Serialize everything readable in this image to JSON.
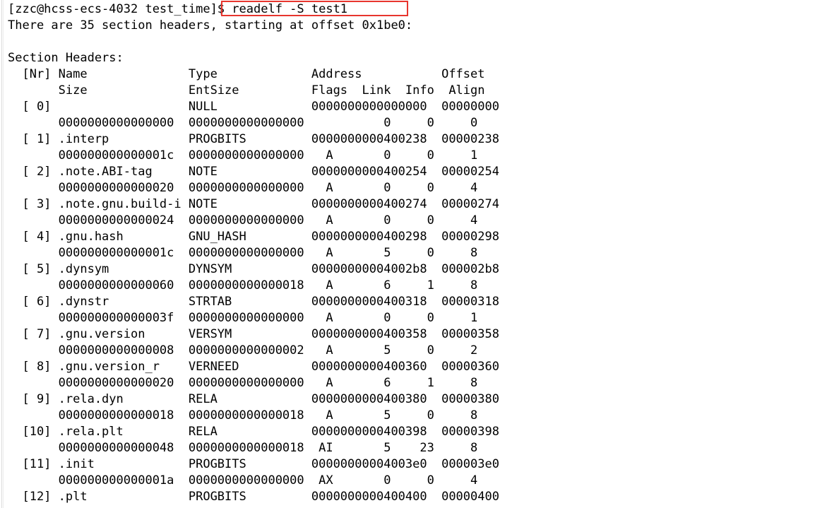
{
  "terminal": {
    "background_color": "#ffffff",
    "text_color": "#000000",
    "highlight_color": "#e8352e",
    "prompt_line": {
      "prompt": "[zzc@hcss-ecs-4032 test_time]$ ",
      "command": "readelf -S test1",
      "full": "[zzc@hcss-ecs-4032 test_time]$ readelf -S test1"
    },
    "summary_line": "There are 35 section headers, starting at offset 0x1be0:",
    "blank_line": "",
    "section_title": "Section Headers:",
    "column_header_line_1": "  [Nr] Name              Type             Address           Offset",
    "column_header_line_2": "       Size              EntSize          Flags  Link  Info  Align",
    "rows": [
      {
        "line_a": "  [ 0]                   NULL             0000000000000000  00000000",
        "line_b": "       0000000000000000  0000000000000000           0     0     0"
      },
      {
        "line_a": "  [ 1] .interp           PROGBITS         0000000000400238  00000238",
        "line_b": "       000000000000001c  0000000000000000   A       0     0     1"
      },
      {
        "line_a": "  [ 2] .note.ABI-tag     NOTE             0000000000400254  00000254",
        "line_b": "       0000000000000020  0000000000000000   A       0     0     4"
      },
      {
        "line_a": "  [ 3] .note.gnu.build-i NOTE             0000000000400274  00000274",
        "line_b": "       0000000000000024  0000000000000000   A       0     0     4"
      },
      {
        "line_a": "  [ 4] .gnu.hash         GNU_HASH         0000000000400298  00000298",
        "line_b": "       000000000000001c  0000000000000000   A       5     0     8"
      },
      {
        "line_a": "  [ 5] .dynsym           DYNSYM           00000000004002b8  000002b8",
        "line_b": "       0000000000000060  0000000000000018   A       6     1     8"
      },
      {
        "line_a": "  [ 6] .dynstr           STRTAB           0000000000400318  00000318",
        "line_b": "       000000000000003f  0000000000000000   A       0     0     1"
      },
      {
        "line_a": "  [ 7] .gnu.version      VERSYM           0000000000400358  00000358",
        "line_b": "       0000000000000008  0000000000000002   A       5     0     2"
      },
      {
        "line_a": "  [ 8] .gnu.version_r    VERNEED          0000000000400360  00000360",
        "line_b": "       0000000000000020  0000000000000000   A       6     1     8"
      },
      {
        "line_a": "  [ 9] .rela.dyn         RELA             0000000000400380  00000380",
        "line_b": "       0000000000000018  0000000000000018   A       5     0     8"
      },
      {
        "line_a": "  [10] .rela.plt         RELA             0000000000400398  00000398",
        "line_b": "       0000000000000048  0000000000000018  AI       5    23     8"
      },
      {
        "line_a": "  [11] .init             PROGBITS         00000000004003e0  000003e0",
        "line_b": "       000000000000001a  0000000000000000  AX       0     0     4"
      },
      {
        "line_a": "  [12] .plt              PROGBITS         0000000000400400  00000400",
        "line_b": ""
      }
    ]
  }
}
